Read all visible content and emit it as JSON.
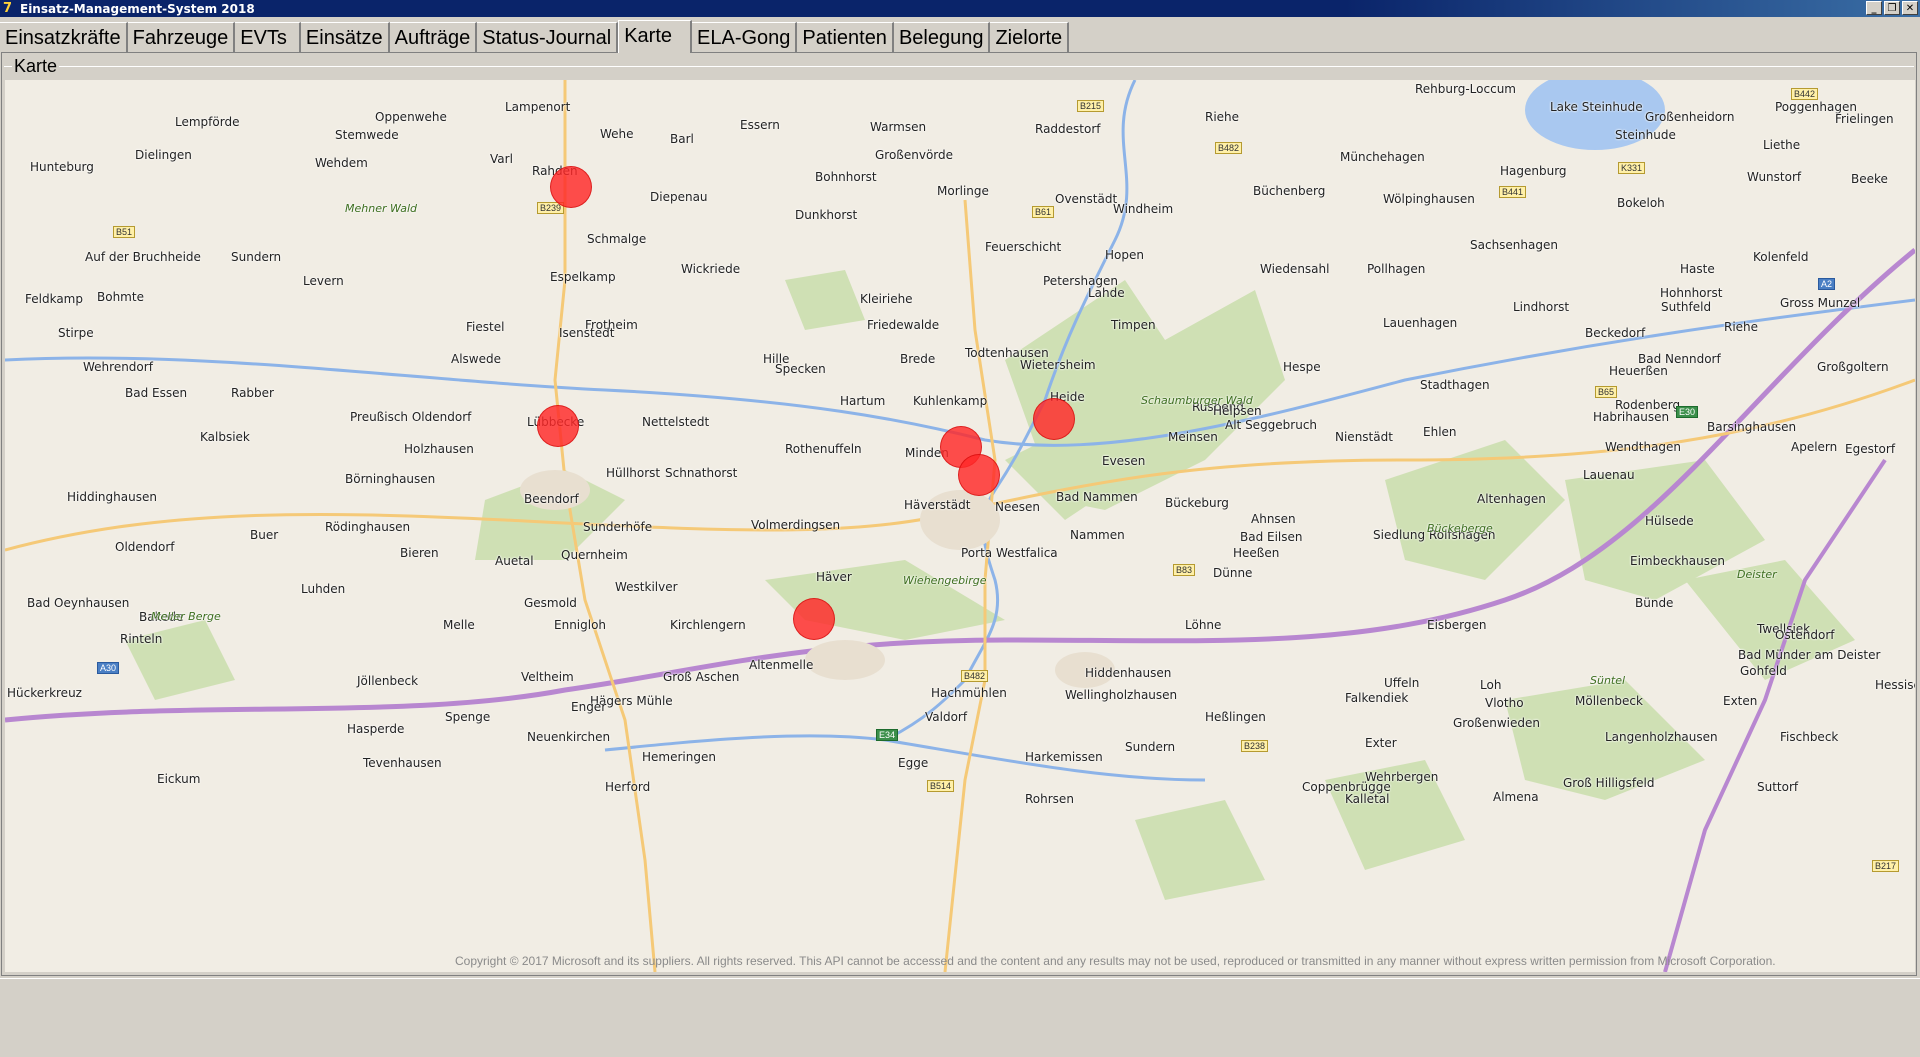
{
  "window": {
    "title": "Einsatz-Management-System 2018",
    "minimize": "_",
    "restore": "❐",
    "close": "✕"
  },
  "tabs": [
    {
      "label": "Einsatzkräfte"
    },
    {
      "label": "Fahrzeuge"
    },
    {
      "label": "EVTs"
    },
    {
      "label": "Einsätze"
    },
    {
      "label": "Aufträge"
    },
    {
      "label": "Status-Journal"
    },
    {
      "label": "Karte"
    },
    {
      "label": "ELA-Gong"
    },
    {
      "label": "Patienten"
    },
    {
      "label": "Belegung"
    },
    {
      "label": "Zielorte"
    }
  ],
  "panel": {
    "title": "Karte"
  },
  "map": {
    "copyright": "Copyright © 2017 Microsoft and its suppliers. All rights reserved. This API cannot be accessed and the content and any results may not be used, reproduced or transmitted in any manner without express written permission from Microsoft Corporation.",
    "places": [
      {
        "name": "Rehburg-Loccum"
      },
      {
        "name": "Lake Steinhude"
      },
      {
        "name": "Lempförde"
      },
      {
        "name": "Oppenwehe"
      },
      {
        "name": "Lampenort"
      },
      {
        "name": "Wehe"
      },
      {
        "name": "Essern"
      },
      {
        "name": "Warmsen"
      },
      {
        "name": "Raddestorf"
      },
      {
        "name": "Riehe"
      },
      {
        "name": "Großenheidorn"
      },
      {
        "name": "Poggenhagen"
      },
      {
        "name": "Frielingen"
      },
      {
        "name": "Stemwede"
      },
      {
        "name": "Barl"
      },
      {
        "name": "Großenvörde"
      },
      {
        "name": "Steinhude"
      },
      {
        "name": "Liethe"
      },
      {
        "name": "Hunteburg"
      },
      {
        "name": "Dielingen"
      },
      {
        "name": "Wehdem"
      },
      {
        "name": "Varl"
      },
      {
        "name": "Münchehagen"
      },
      {
        "name": "Rahden"
      },
      {
        "name": "Bohnhorst"
      },
      {
        "name": "Hagenburg"
      },
      {
        "name": "Wunstorf"
      },
      {
        "name": "Beeke"
      },
      {
        "name": "Diepenau"
      },
      {
        "name": "Morlinge"
      },
      {
        "name": "Ovenstädt"
      },
      {
        "name": "Windheim"
      },
      {
        "name": "Büchenberg"
      },
      {
        "name": "Wölpinghausen"
      },
      {
        "name": "Bokeloh"
      },
      {
        "name": "Dunkhorst"
      },
      {
        "name": "Schmalge"
      },
      {
        "name": "Feuerschicht"
      },
      {
        "name": "Sachsenhagen"
      },
      {
        "name": "Auf der Bruchheide"
      },
      {
        "name": "Sundern"
      },
      {
        "name": "Hopen"
      },
      {
        "name": "Kolenfeld"
      },
      {
        "name": "Wickriede"
      },
      {
        "name": "Wiedensahl"
      },
      {
        "name": "Pollhagen"
      },
      {
        "name": "Haste"
      },
      {
        "name": "Levern"
      },
      {
        "name": "Espelkamp"
      },
      {
        "name": "Petershagen"
      },
      {
        "name": "Lahde"
      },
      {
        "name": "Hohnhorst"
      },
      {
        "name": "Feldkamp"
      },
      {
        "name": "Bohmte"
      },
      {
        "name": "Kleiriehe"
      },
      {
        "name": "Lindhorst"
      },
      {
        "name": "Suthfeld"
      },
      {
        "name": "Gross Munzel"
      },
      {
        "name": "Fiestel"
      },
      {
        "name": "Frotheim"
      },
      {
        "name": "Friedewalde"
      },
      {
        "name": "Timpen"
      },
      {
        "name": "Lauenhagen"
      },
      {
        "name": "Riehe"
      },
      {
        "name": "Stirpe"
      },
      {
        "name": "Isenstedt"
      },
      {
        "name": "Beckedorf"
      },
      {
        "name": "Alswede"
      },
      {
        "name": "Hille"
      },
      {
        "name": "Todtenhausen"
      },
      {
        "name": "Brede"
      },
      {
        "name": "Wietersheim"
      },
      {
        "name": "Hespe"
      },
      {
        "name": "Bad Nenndorf"
      },
      {
        "name": "Großgoltern"
      },
      {
        "name": "Wehrendorf"
      },
      {
        "name": "Specken"
      },
      {
        "name": "Heuerßen"
      },
      {
        "name": "Bad Essen"
      },
      {
        "name": "Rabber"
      },
      {
        "name": "Hartum"
      },
      {
        "name": "Kuhlenkamp"
      },
      {
        "name": "Heide"
      },
      {
        "name": "Rusbend"
      },
      {
        "name": "Stadthagen"
      },
      {
        "name": "Rodenberg"
      },
      {
        "name": "Preußisch Oldendorf"
      },
      {
        "name": "Helpsen"
      },
      {
        "name": "Habrihausen"
      },
      {
        "name": "Barsinghausen"
      },
      {
        "name": "Lübbecke"
      },
      {
        "name": "Nettelstedt"
      },
      {
        "name": "Alt Seggebruch"
      },
      {
        "name": "Kalbsiek"
      },
      {
        "name": "Meinsen"
      },
      {
        "name": "Ehlen"
      },
      {
        "name": "Nienstädt"
      },
      {
        "name": "Holzhausen"
      },
      {
        "name": "Rothenuffeln"
      },
      {
        "name": "Minden"
      },
      {
        "name": "Wendthagen"
      },
      {
        "name": "Apelern"
      },
      {
        "name": "Egestorf"
      },
      {
        "name": "Evesen"
      },
      {
        "name": "Hüllhorst"
      },
      {
        "name": "Schnathorst"
      },
      {
        "name": "Börninghausen"
      },
      {
        "name": "Lauenau"
      },
      {
        "name": "Hiddinghausen"
      },
      {
        "name": "Beendorf"
      },
      {
        "name": "Bad Nammen"
      },
      {
        "name": "Häverstädt"
      },
      {
        "name": "Neesen"
      },
      {
        "name": "Bückeburg"
      },
      {
        "name": "Altenhagen"
      },
      {
        "name": "Ahnsen"
      },
      {
        "name": "Rödinghausen"
      },
      {
        "name": "Sunderhöfe"
      },
      {
        "name": "Volmerdingsen"
      },
      {
        "name": "Hülsede"
      },
      {
        "name": "Buer"
      },
      {
        "name": "Nammen"
      },
      {
        "name": "Bad Eilsen"
      },
      {
        "name": "Siedlung Rolfshagen"
      },
      {
        "name": "Oldendorf"
      },
      {
        "name": "Bieren"
      },
      {
        "name": "Quernheim"
      },
      {
        "name": "Porta Westfalica"
      },
      {
        "name": "Heeßen"
      },
      {
        "name": "Eimbeckhausen"
      },
      {
        "name": "Auetal"
      },
      {
        "name": "Dünne"
      },
      {
        "name": "Luhden"
      },
      {
        "name": "Westkilver"
      },
      {
        "name": "Häver"
      },
      {
        "name": "Bad Oeynhausen"
      },
      {
        "name": "Gesmold"
      },
      {
        "name": "Bünde"
      },
      {
        "name": "Bakede"
      },
      {
        "name": "Melle"
      },
      {
        "name": "Ennigloh"
      },
      {
        "name": "Kirchlengern"
      },
      {
        "name": "Löhne"
      },
      {
        "name": "Twellsiek"
      },
      {
        "name": "Eisbergen"
      },
      {
        "name": "Rinteln"
      },
      {
        "name": "Ostendorf"
      },
      {
        "name": "Bad Münder am Deister"
      },
      {
        "name": "Altenmelle"
      },
      {
        "name": "Gohfeld"
      },
      {
        "name": "Jöllenbeck"
      },
      {
        "name": "Veltheim"
      },
      {
        "name": "Groß Aschen"
      },
      {
        "name": "Uffeln"
      },
      {
        "name": "Loh"
      },
      {
        "name": "Hessisch Oldendorf"
      },
      {
        "name": "Vlotho"
      },
      {
        "name": "Exten"
      },
      {
        "name": "Großenwieden"
      },
      {
        "name": "Hiddenhausen"
      },
      {
        "name": "Hägers Mühle"
      },
      {
        "name": "Hachmühlen"
      },
      {
        "name": "Wellingholzhausen"
      },
      {
        "name": "Falkendiek"
      },
      {
        "name": "Möllenbeck"
      },
      {
        "name": "Hückerkreuz"
      },
      {
        "name": "Enger"
      },
      {
        "name": "Valdorf"
      },
      {
        "name": "Heßlingen"
      },
      {
        "name": "Spenge"
      },
      {
        "name": "Langenholzhausen"
      },
      {
        "name": "Fischbeck"
      },
      {
        "name": "Hasperde"
      },
      {
        "name": "Neuenkirchen"
      },
      {
        "name": "Sundern"
      },
      {
        "name": "Egge"
      },
      {
        "name": "Exter"
      },
      {
        "name": "Tevenhausen"
      },
      {
        "name": "Hemeringen"
      },
      {
        "name": "Harkemissen"
      },
      {
        "name": "Wehrbergen"
      },
      {
        "name": "Groß Hilligsfeld"
      },
      {
        "name": "Suttorf"
      },
      {
        "name": "Eickum"
      },
      {
        "name": "Herford"
      },
      {
        "name": "Coppenbrügge"
      },
      {
        "name": "Rohrsen"
      },
      {
        "name": "Kalletal"
      },
      {
        "name": "Almena"
      }
    ],
    "regions": [
      {
        "name": "Mehner Wald"
      },
      {
        "name": "Schaumburger Wald"
      },
      {
        "name": "Bückeberge"
      },
      {
        "name": "Wiehengebirge"
      },
      {
        "name": "Meller Berge"
      },
      {
        "name": "Deister"
      },
      {
        "name": "Süntel"
      }
    ],
    "roads": [
      {
        "name": "B215"
      },
      {
        "name": "B482"
      },
      {
        "name": "B442"
      },
      {
        "name": "B51"
      },
      {
        "name": "B239"
      },
      {
        "name": "B441"
      },
      {
        "name": "K331"
      },
      {
        "name": "B61"
      },
      {
        "name": "A2"
      },
      {
        "name": "B65"
      },
      {
        "name": "E30"
      },
      {
        "name": "B83"
      },
      {
        "name": "B482"
      },
      {
        "name": "A30"
      },
      {
        "name": "E34"
      },
      {
        "name": "B514"
      },
      {
        "name": "B238"
      },
      {
        "name": "B217"
      }
    ],
    "incidents": [
      {
        "name": "incident-1"
      },
      {
        "name": "incident-2"
      },
      {
        "name": "incident-3"
      },
      {
        "name": "incident-4"
      },
      {
        "name": "incident-5"
      },
      {
        "name": "incident-6"
      }
    ]
  }
}
